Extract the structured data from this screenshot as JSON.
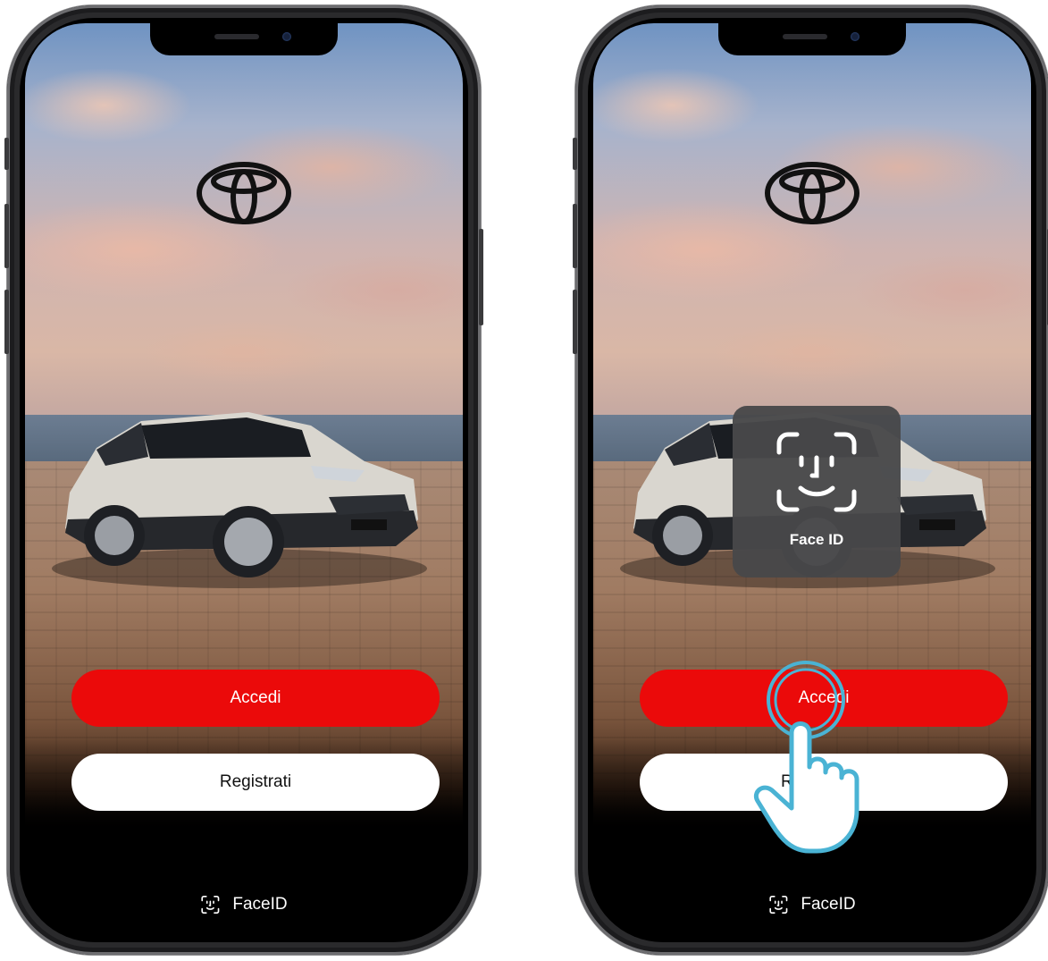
{
  "left_phone": {
    "brand_logo": "toyota-logo",
    "login_button": "Accedi",
    "register_button": "Registrati",
    "faceid_link": "FaceID"
  },
  "right_phone": {
    "brand_logo": "toyota-logo",
    "login_button": "Accedi",
    "register_button": "Re",
    "faceid_link": "FaceID",
    "faceid_popup": "Face ID"
  },
  "colors": {
    "primary_button": "#eb0a0a",
    "secondary_button": "#ffffff",
    "tap_indicator": "#4ab3d4",
    "popup_background": "#48484a"
  },
  "icons": [
    "toyota-logo",
    "face-id-icon",
    "tap-hand-icon"
  ]
}
